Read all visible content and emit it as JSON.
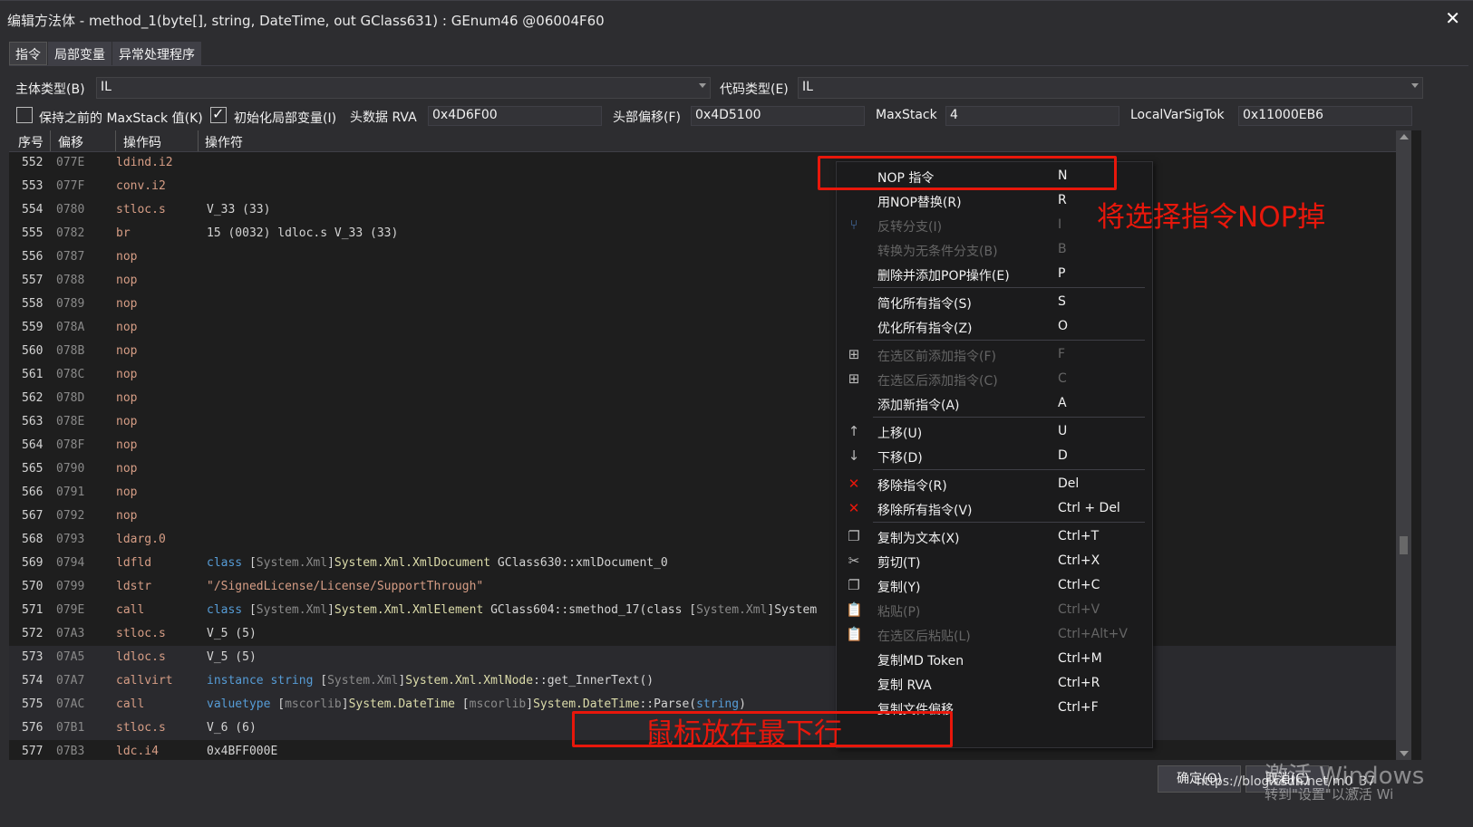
{
  "window": {
    "title": "编辑方法体 - method_1(byte[], string, DateTime, out GClass631) : GEnum46 @06004F60",
    "close_glyph": "✕"
  },
  "tabs": [
    {
      "label": "指令"
    },
    {
      "label": "局部变量"
    },
    {
      "label": "异常处理程序"
    }
  ],
  "settings": {
    "body_type_label": "主体类型(B)",
    "body_type_value": "IL",
    "code_type_label": "代码类型(E)",
    "code_type_value": "IL",
    "keep_maxstack_label": "保持之前的 MaxStack 值(K)",
    "keep_maxstack_checked": false,
    "init_locals_label": "初始化局部变量(I)",
    "init_locals_checked": true,
    "header_rva_label": "头数据 RVA",
    "header_rva_value": "0x4D6F00",
    "header_offset_label": "头部偏移(F)",
    "header_offset_value": "0x4D5100",
    "maxstack_label": "MaxStack",
    "maxstack_value": "4",
    "localvarsig_label": "LocalVarSigTok",
    "localvarsig_value": "0x11000EB6"
  },
  "grid": {
    "columns": [
      "序号",
      "偏移",
      "操作码",
      "操作符"
    ],
    "rows": [
      {
        "idx": "552",
        "off": "077E",
        "op": "ldind.i2",
        "arg": ""
      },
      {
        "idx": "553",
        "off": "077F",
        "op": "conv.i2",
        "arg": ""
      },
      {
        "idx": "554",
        "off": "0780",
        "op": "stloc.s",
        "arg": "V_33 (33)"
      },
      {
        "idx": "555",
        "off": "0782",
        "op": "br",
        "arg": "15 (0032) ldloc.s V_33 (33)"
      },
      {
        "idx": "556",
        "off": "0787",
        "op": "nop",
        "arg": ""
      },
      {
        "idx": "557",
        "off": "0788",
        "op": "nop",
        "arg": ""
      },
      {
        "idx": "558",
        "off": "0789",
        "op": "nop",
        "arg": ""
      },
      {
        "idx": "559",
        "off": "078A",
        "op": "nop",
        "arg": ""
      },
      {
        "idx": "560",
        "off": "078B",
        "op": "nop",
        "arg": ""
      },
      {
        "idx": "561",
        "off": "078C",
        "op": "nop",
        "arg": ""
      },
      {
        "idx": "562",
        "off": "078D",
        "op": "nop",
        "arg": ""
      },
      {
        "idx": "563",
        "off": "078E",
        "op": "nop",
        "arg": ""
      },
      {
        "idx": "564",
        "off": "078F",
        "op": "nop",
        "arg": ""
      },
      {
        "idx": "565",
        "off": "0790",
        "op": "nop",
        "arg": ""
      },
      {
        "idx": "566",
        "off": "0791",
        "op": "nop",
        "arg": ""
      },
      {
        "idx": "567",
        "off": "0792",
        "op": "nop",
        "arg": ""
      },
      {
        "idx": "568",
        "off": "0793",
        "op": "ldarg.0",
        "arg": ""
      },
      {
        "idx": "569",
        "off": "0794",
        "op": "ldfld",
        "arg": "class [System.Xml]System.Xml.XmlDocument GClass630::xmlDocument_0"
      },
      {
        "idx": "570",
        "off": "0799",
        "op": "ldstr",
        "arg": "\"/SignedLicense/License/SupportThrough\""
      },
      {
        "idx": "571",
        "off": "079E",
        "op": "call",
        "arg": "class [System.Xml]System.Xml.XmlElement GClass604::smethod_17(class [System.Xml]System"
      },
      {
        "idx": "572",
        "off": "07A3",
        "op": "stloc.s",
        "arg": "V_5 (5)"
      },
      {
        "idx": "573",
        "off": "07A5",
        "op": "ldloc.s",
        "arg": "V_5 (5)",
        "selected": true
      },
      {
        "idx": "574",
        "off": "07A7",
        "op": "callvirt",
        "arg": "instance string [System.Xml]System.Xml.XmlNode::get_InnerText()",
        "selected": true
      },
      {
        "idx": "575",
        "off": "07AC",
        "op": "call",
        "arg": "valuetype [mscorlib]System.DateTime [mscorlib]System.DateTime::Parse(string)",
        "selected": true
      },
      {
        "idx": "576",
        "off": "07B1",
        "op": "stloc.s",
        "arg": "V_6 (6)",
        "selected": true
      },
      {
        "idx": "577",
        "off": "07B3",
        "op": "ldc.i4",
        "arg": "0x4BFF000E"
      }
    ]
  },
  "context_menu": {
    "items": [
      {
        "icon": "",
        "label": "NOP 指令",
        "key": "N",
        "disabled": false
      },
      {
        "icon": "",
        "label": "用NOP替换(R)",
        "key": "R",
        "disabled": false
      },
      {
        "icon": "branch-icon",
        "label": "反转分支(I)",
        "key": "I",
        "disabled": true
      },
      {
        "icon": "",
        "label": "转换为无条件分支(B)",
        "key": "B",
        "disabled": true
      },
      {
        "icon": "",
        "label": "删除并添加POP操作(E)",
        "key": "P",
        "disabled": false
      },
      {
        "icon": "",
        "label": "简化所有指令(S)",
        "key": "S",
        "disabled": false
      },
      {
        "icon": "",
        "label": "优化所有指令(Z)",
        "key": "O",
        "disabled": false
      },
      {
        "icon": "add-before-icon",
        "label": "在选区前添加指令(F)",
        "key": "F",
        "disabled": true
      },
      {
        "icon": "add-after-icon",
        "label": "在选区后添加指令(C)",
        "key": "C",
        "disabled": true
      },
      {
        "icon": "",
        "label": "添加新指令(A)",
        "key": "A",
        "disabled": false
      },
      {
        "icon": "arrow-up-icon",
        "label": "上移(U)",
        "key": "U",
        "disabled": false
      },
      {
        "icon": "arrow-down-icon",
        "label": "下移(D)",
        "key": "D",
        "disabled": false
      },
      {
        "icon": "delete-x-icon",
        "label": "移除指令(R)",
        "key": "Del",
        "disabled": false
      },
      {
        "icon": "delete-x-icon",
        "label": "移除所有指令(V)",
        "key": "Ctrl + Del",
        "disabled": false
      },
      {
        "icon": "copy-icon",
        "label": "复制为文本(X)",
        "key": "Ctrl+T",
        "disabled": false
      },
      {
        "icon": "scissors-icon",
        "label": "剪切(T)",
        "key": "Ctrl+X",
        "disabled": false
      },
      {
        "icon": "copy-icon",
        "label": "复制(Y)",
        "key": "Ctrl+C",
        "disabled": false
      },
      {
        "icon": "paste-icon",
        "label": "粘贴(P)",
        "key": "Ctrl+V",
        "disabled": true
      },
      {
        "icon": "paste-icon",
        "label": "在选区后粘贴(L)",
        "key": "Ctrl+Alt+V",
        "disabled": true
      },
      {
        "icon": "",
        "label": "复制MD Token",
        "key": "Ctrl+M",
        "disabled": false
      },
      {
        "icon": "",
        "label": "复制 RVA",
        "key": "Ctrl+R",
        "disabled": false
      },
      {
        "icon": "",
        "label": "复制文件偏移",
        "key": "Ctrl+F",
        "disabled": false
      }
    ]
  },
  "annotations": {
    "nop_note": "将选择指令NOP掉",
    "mouse_note": "鼠标放在最下行"
  },
  "buttons": {
    "ok": "确定(O)",
    "cancel": "取消(C)"
  },
  "watermarks": {
    "activate": "激活 Windows",
    "activate_sub": "转到\"设置\"以激活 Wi",
    "url": "https://blog.csdn.net/m0_37"
  },
  "colors": {
    "annotation_red": "#e8170b",
    "keyword_blue": "#569cd6",
    "type_yellow": "#dcdcaa",
    "assembly_gray": "#8a8a8a",
    "string_orange": "#d69d85"
  }
}
